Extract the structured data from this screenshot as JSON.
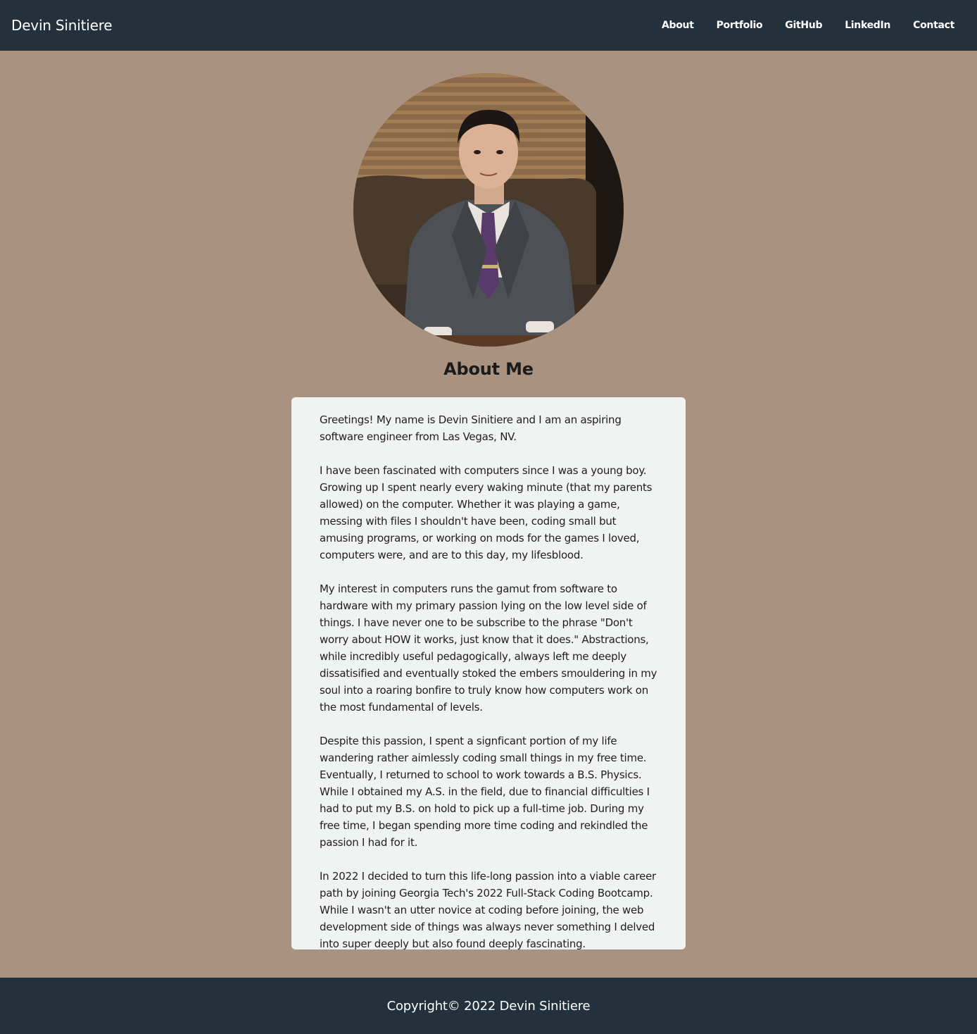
{
  "colors": {
    "navbar_bg": "#22313c",
    "page_bg": "#aa9280",
    "card_bg": "#f1f3f2",
    "text": "#1e1e1e",
    "nav_text": "#ffffff"
  },
  "navbar": {
    "brand": "Devin Sinitiere",
    "links": [
      {
        "label": "About"
      },
      {
        "label": "Portfolio"
      },
      {
        "label": "GitHub"
      },
      {
        "label": "LinkedIn"
      },
      {
        "label": "Contact"
      }
    ]
  },
  "about": {
    "title": "About Me",
    "paragraphs": [
      "Greetings! My name is Devin Sinitiere and I am an aspiring software engineer from Las Vegas, NV.",
      "I have been fascinated with computers since I was a young boy. Growing up I spent nearly every waking minute (that my parents allowed) on the computer. Whether it was playing a game, messing with files I shouldn't have been, coding small but amusing programs, or working on mods for the games I loved, computers were, and are to this day, my lifesblood.",
      "My interest in computers runs the gamut from software to hardware with my primary passion lying on the low level side of things. I have never one to be subscribe to the phrase \"Don't worry about HOW it works, just know that it does.\" Abstractions, while incredibly useful pedagogically, always left me deeply dissatisified and eventually stoked the embers smouldering in my soul into a roaring bonfire to truly know how computers work on the most fundamental of levels.",
      "Despite this passion, I spent a signficant portion of my life wandering rather aimlessly coding small things in my free time. Eventually, I returned to school to work towards a B.S. Physics. While I obtained my A.S. in the field, due to financial difficulties I had to put my B.S. on hold to pick up a full-time job. During my free time, I began spending more time coding and rekindled the passion I had for it.",
      "In 2022 I decided to turn this life-long passion into a viable career path by joining Georgia Tech's 2022 Full-Stack Coding Bootcamp. While I wasn't an utter novice at coding before joining, the web development side of things was always never something I delved into super deeply but also found deeply fascinating."
    ]
  },
  "footer": {
    "copyright": "Copyright© 2022 Devin Sinitiere"
  }
}
